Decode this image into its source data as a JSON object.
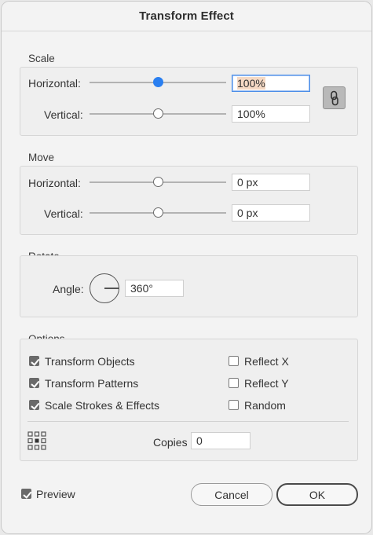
{
  "dialog": {
    "title": "Transform Effect"
  },
  "scale": {
    "section_label": "Scale",
    "horizontal": {
      "label": "Horizontal:",
      "value": "100%",
      "slider_fraction": 0.5
    },
    "vertical": {
      "label": "Vertical:",
      "value": "100%",
      "slider_fraction": 0.5
    },
    "link_icon": "link-chain-icon"
  },
  "move": {
    "section_label": "Move",
    "horizontal": {
      "label": "Horizontal:",
      "value": "0 px",
      "slider_fraction": 0.5
    },
    "vertical": {
      "label": "Vertical:",
      "value": "0 px",
      "slider_fraction": 0.5
    }
  },
  "rotate": {
    "section_label": "Rotate",
    "angle_label": "Angle:",
    "angle_value": "360°"
  },
  "options": {
    "section_label": "Options",
    "transform_objects": {
      "label": "Transform Objects",
      "checked": true
    },
    "transform_patterns": {
      "label": "Transform Patterns",
      "checked": true
    },
    "scale_strokes": {
      "label": "Scale Strokes & Effects",
      "checked": true
    },
    "reflect_x": {
      "label": "Reflect X",
      "checked": false
    },
    "reflect_y": {
      "label": "Reflect Y",
      "checked": false
    },
    "random": {
      "label": "Random",
      "checked": false
    },
    "reference_point_icon": "reference-point-icon",
    "copies_label": "Copies",
    "copies_value": "0"
  },
  "footer": {
    "preview": {
      "label": "Preview",
      "checked": true
    },
    "cancel_label": "Cancel",
    "ok_label": "OK"
  },
  "colors": {
    "accent": "#2a7ff0",
    "focus_ring": "#4c8ee8",
    "selection": "#f5d9c4"
  }
}
